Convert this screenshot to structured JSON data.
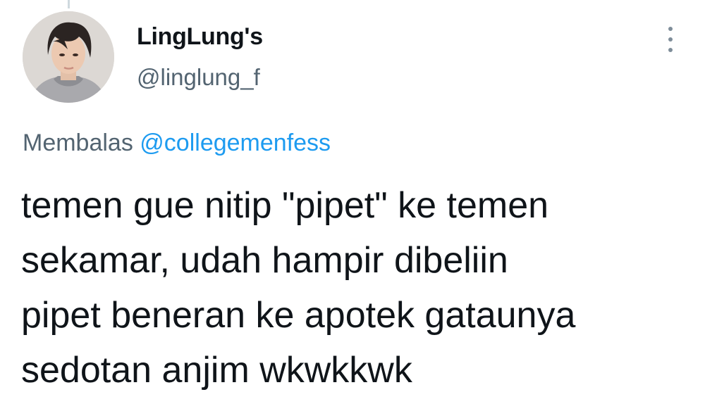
{
  "user": {
    "display_name": "LingLung's",
    "handle": "@linglung_f",
    "avatar_icon": "profile-photo"
  },
  "reply": {
    "prefix": "Membalas",
    "mention": "@collegemenfess"
  },
  "tweet": {
    "lines": [
      "temen gue nitip \"pipet\" ke temen",
      "sekamar, udah hampir dibeliin",
      "pipet beneran ke apotek gataunya",
      "sedotan anjim wkwkkwk"
    ]
  },
  "icons": {
    "more": "more-vertical-icon"
  },
  "colors": {
    "text": "#0f1419",
    "secondary": "#536471",
    "link": "#1d9bf0"
  }
}
